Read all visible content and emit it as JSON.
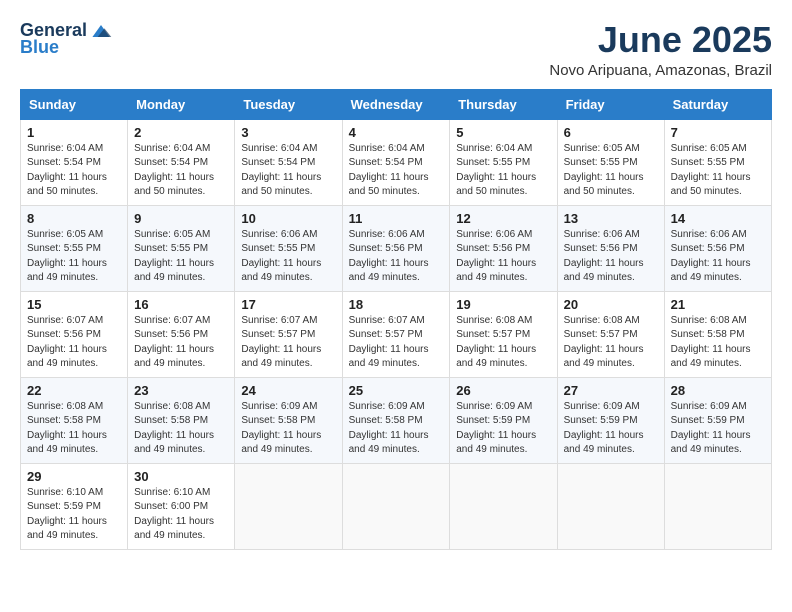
{
  "logo": {
    "general": "General",
    "blue": "Blue"
  },
  "title": {
    "month_year": "June 2025",
    "location": "Novo Aripuana, Amazonas, Brazil"
  },
  "headers": [
    "Sunday",
    "Monday",
    "Tuesday",
    "Wednesday",
    "Thursday",
    "Friday",
    "Saturday"
  ],
  "weeks": [
    [
      {
        "day": "1",
        "sunrise": "6:04 AM",
        "sunset": "5:54 PM",
        "daylight": "11 hours and 50 minutes."
      },
      {
        "day": "2",
        "sunrise": "6:04 AM",
        "sunset": "5:54 PM",
        "daylight": "11 hours and 50 minutes."
      },
      {
        "day": "3",
        "sunrise": "6:04 AM",
        "sunset": "5:54 PM",
        "daylight": "11 hours and 50 minutes."
      },
      {
        "day": "4",
        "sunrise": "6:04 AM",
        "sunset": "5:54 PM",
        "daylight": "11 hours and 50 minutes."
      },
      {
        "day": "5",
        "sunrise": "6:04 AM",
        "sunset": "5:55 PM",
        "daylight": "11 hours and 50 minutes."
      },
      {
        "day": "6",
        "sunrise": "6:05 AM",
        "sunset": "5:55 PM",
        "daylight": "11 hours and 50 minutes."
      },
      {
        "day": "7",
        "sunrise": "6:05 AM",
        "sunset": "5:55 PM",
        "daylight": "11 hours and 50 minutes."
      }
    ],
    [
      {
        "day": "8",
        "sunrise": "6:05 AM",
        "sunset": "5:55 PM",
        "daylight": "11 hours and 49 minutes."
      },
      {
        "day": "9",
        "sunrise": "6:05 AM",
        "sunset": "5:55 PM",
        "daylight": "11 hours and 49 minutes."
      },
      {
        "day": "10",
        "sunrise": "6:06 AM",
        "sunset": "5:55 PM",
        "daylight": "11 hours and 49 minutes."
      },
      {
        "day": "11",
        "sunrise": "6:06 AM",
        "sunset": "5:56 PM",
        "daylight": "11 hours and 49 minutes."
      },
      {
        "day": "12",
        "sunrise": "6:06 AM",
        "sunset": "5:56 PM",
        "daylight": "11 hours and 49 minutes."
      },
      {
        "day": "13",
        "sunrise": "6:06 AM",
        "sunset": "5:56 PM",
        "daylight": "11 hours and 49 minutes."
      },
      {
        "day": "14",
        "sunrise": "6:06 AM",
        "sunset": "5:56 PM",
        "daylight": "11 hours and 49 minutes."
      }
    ],
    [
      {
        "day": "15",
        "sunrise": "6:07 AM",
        "sunset": "5:56 PM",
        "daylight": "11 hours and 49 minutes."
      },
      {
        "day": "16",
        "sunrise": "6:07 AM",
        "sunset": "5:56 PM",
        "daylight": "11 hours and 49 minutes."
      },
      {
        "day": "17",
        "sunrise": "6:07 AM",
        "sunset": "5:57 PM",
        "daylight": "11 hours and 49 minutes."
      },
      {
        "day": "18",
        "sunrise": "6:07 AM",
        "sunset": "5:57 PM",
        "daylight": "11 hours and 49 minutes."
      },
      {
        "day": "19",
        "sunrise": "6:08 AM",
        "sunset": "5:57 PM",
        "daylight": "11 hours and 49 minutes."
      },
      {
        "day": "20",
        "sunrise": "6:08 AM",
        "sunset": "5:57 PM",
        "daylight": "11 hours and 49 minutes."
      },
      {
        "day": "21",
        "sunrise": "6:08 AM",
        "sunset": "5:58 PM",
        "daylight": "11 hours and 49 minutes."
      }
    ],
    [
      {
        "day": "22",
        "sunrise": "6:08 AM",
        "sunset": "5:58 PM",
        "daylight": "11 hours and 49 minutes."
      },
      {
        "day": "23",
        "sunrise": "6:08 AM",
        "sunset": "5:58 PM",
        "daylight": "11 hours and 49 minutes."
      },
      {
        "day": "24",
        "sunrise": "6:09 AM",
        "sunset": "5:58 PM",
        "daylight": "11 hours and 49 minutes."
      },
      {
        "day": "25",
        "sunrise": "6:09 AM",
        "sunset": "5:58 PM",
        "daylight": "11 hours and 49 minutes."
      },
      {
        "day": "26",
        "sunrise": "6:09 AM",
        "sunset": "5:59 PM",
        "daylight": "11 hours and 49 minutes."
      },
      {
        "day": "27",
        "sunrise": "6:09 AM",
        "sunset": "5:59 PM",
        "daylight": "11 hours and 49 minutes."
      },
      {
        "day": "28",
        "sunrise": "6:09 AM",
        "sunset": "5:59 PM",
        "daylight": "11 hours and 49 minutes."
      }
    ],
    [
      {
        "day": "29",
        "sunrise": "6:10 AM",
        "sunset": "5:59 PM",
        "daylight": "11 hours and 49 minutes."
      },
      {
        "day": "30",
        "sunrise": "6:10 AM",
        "sunset": "6:00 PM",
        "daylight": "11 hours and 49 minutes."
      },
      null,
      null,
      null,
      null,
      null
    ]
  ]
}
